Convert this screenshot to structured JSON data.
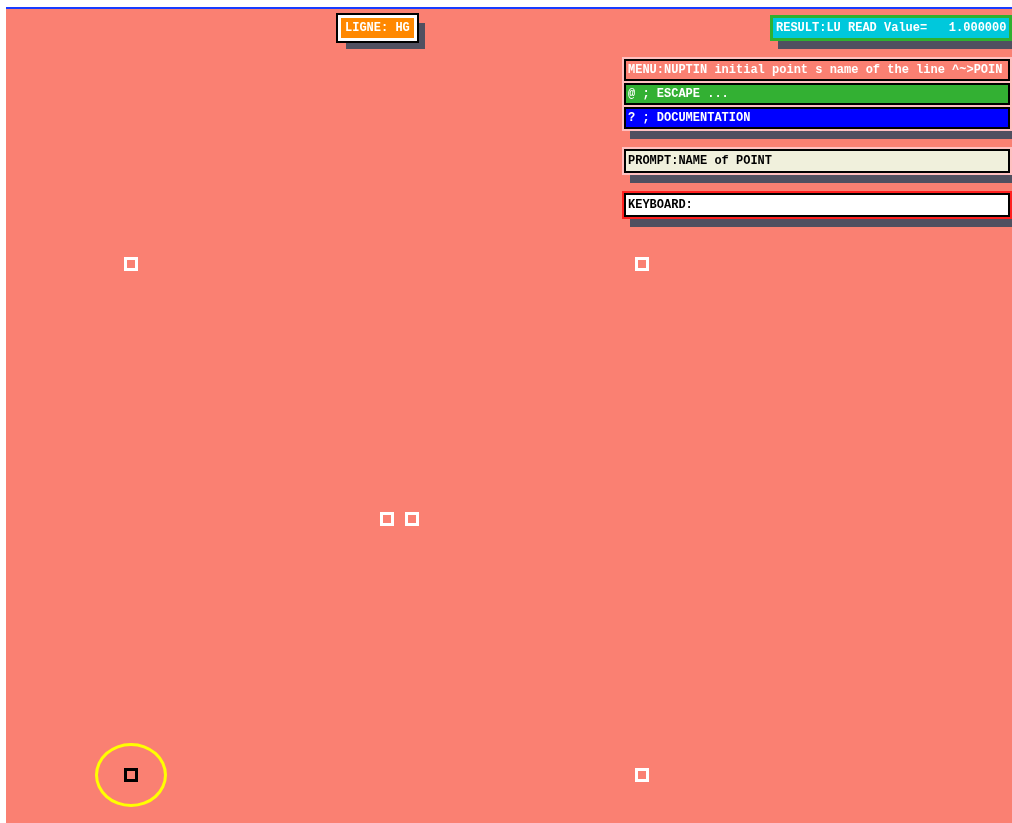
{
  "line_label": "LIGNE: HG",
  "result": "RESULT:LU READ Value=   1.000000",
  "menu": {
    "title": "MENU:NUPTIN initial point s name of the line ^~>POIN",
    "items": [
      {
        "label": "@ ; ESCAPE ...",
        "color": "#33b033"
      },
      {
        "label": "? ; DOCUMENTATION",
        "color": "#0000ff"
      }
    ]
  },
  "prompt": "PROMPT:NAME of POINT",
  "keyboard": {
    "label": "KEYBOARD:"
  },
  "points": [
    {
      "selected": false
    },
    {
      "selected": false
    },
    {
      "selected": false
    },
    {
      "selected": false
    },
    {
      "selected": true
    },
    {
      "selected": false
    }
  ]
}
